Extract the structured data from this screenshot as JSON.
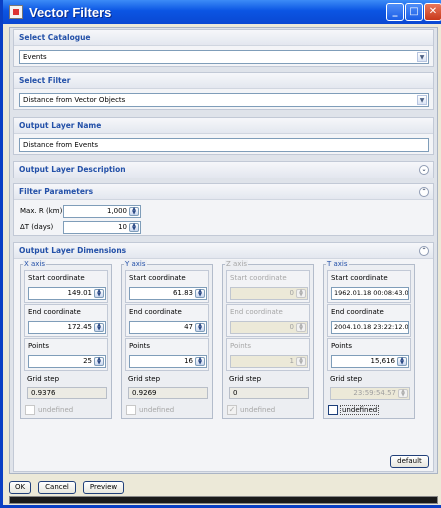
{
  "window": {
    "title": "Vector Filters"
  },
  "select_catalogue": {
    "header": "Select Catalogue",
    "value": "Events"
  },
  "select_filter": {
    "header": "Select Filter",
    "value": "Distance from Vector Objects"
  },
  "output_layer_name": {
    "header": "Output Layer Name",
    "value": "Distance from Events"
  },
  "output_layer_description": {
    "header": "Output Layer Description"
  },
  "filter_parameters": {
    "header": "Filter Parameters",
    "max_r_label": "Max. R (km)",
    "max_r_value": "1,000",
    "dt_label": "ΔT (days)",
    "dt_value": "10"
  },
  "output_layer_dimensions": {
    "header": "Output Layer Dimensions",
    "start_label": "Start coordinate",
    "end_label": "End coordinate",
    "points_label": "Points",
    "grid_label": "Grid step",
    "undefined_label": "undefined",
    "default_label": "default",
    "axes": [
      {
        "name": "X axis",
        "start": "149.01",
        "end": "172.45",
        "points": "25",
        "grid": "0.9376"
      },
      {
        "name": "Y axis",
        "start": "61.83",
        "end": "47",
        "points": "16",
        "grid": "0.9269"
      },
      {
        "name": "Z axis",
        "start": "0",
        "end": "0",
        "points": "1",
        "grid": "0"
      },
      {
        "name": "T axis",
        "start": "1962.01.18 00:08:43.000",
        "end": "2004.10.18 23:22:12.000",
        "points": "15,616",
        "grid": "23:59:54.57"
      }
    ]
  },
  "footer": {
    "ok": "OK",
    "cancel": "Cancel",
    "preview": "Preview"
  }
}
